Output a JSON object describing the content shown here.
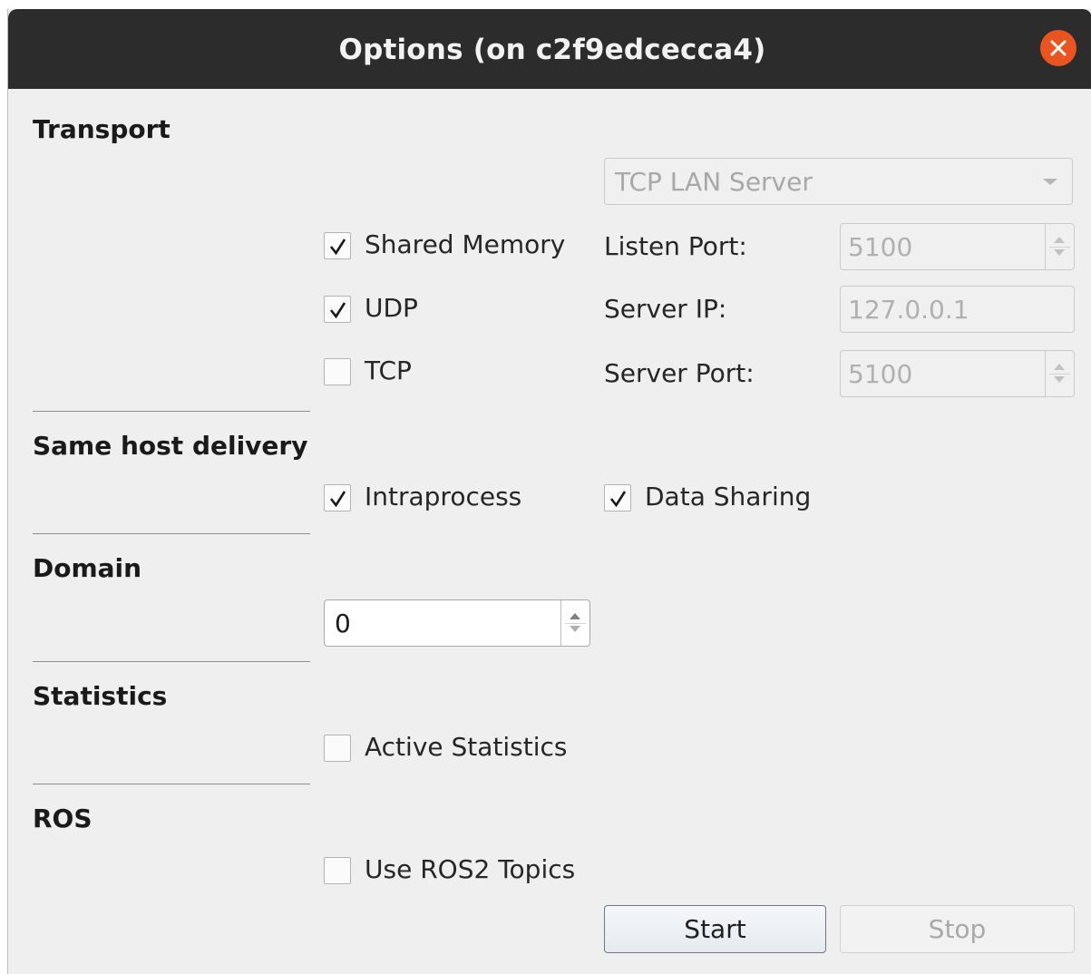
{
  "window": {
    "title": "Options (on c2f9edcecca4)"
  },
  "transport": {
    "heading": "Transport",
    "mode": "TCP LAN Server",
    "checkboxes": [
      {
        "label": "Shared Memory",
        "checked": true
      },
      {
        "label": "UDP",
        "checked": true
      },
      {
        "label": "TCP",
        "checked": false
      }
    ],
    "listen_port_label": "Listen Port:",
    "listen_port_value": "5100",
    "server_ip_label": "Server IP:",
    "server_ip_value": "127.0.0.1",
    "server_port_label": "Server Port:",
    "server_port_value": "5100"
  },
  "same_host": {
    "heading": "Same host delivery",
    "checkboxes": [
      {
        "label": "Intraprocess",
        "checked": true
      },
      {
        "label": "Data Sharing",
        "checked": true
      }
    ]
  },
  "domain": {
    "heading": "Domain",
    "value": "0"
  },
  "statistics": {
    "heading": "Statistics",
    "checkbox": {
      "label": "Active Statistics",
      "checked": false
    }
  },
  "ros": {
    "heading": "ROS",
    "checkbox": {
      "label": "Use ROS2 Topics",
      "checked": false
    }
  },
  "buttons": {
    "start_label": "Start",
    "stop_label": "Stop"
  },
  "colors": {
    "titlebar": "#2c2c2c",
    "close_button": "#e95420",
    "background": "#efefef"
  }
}
